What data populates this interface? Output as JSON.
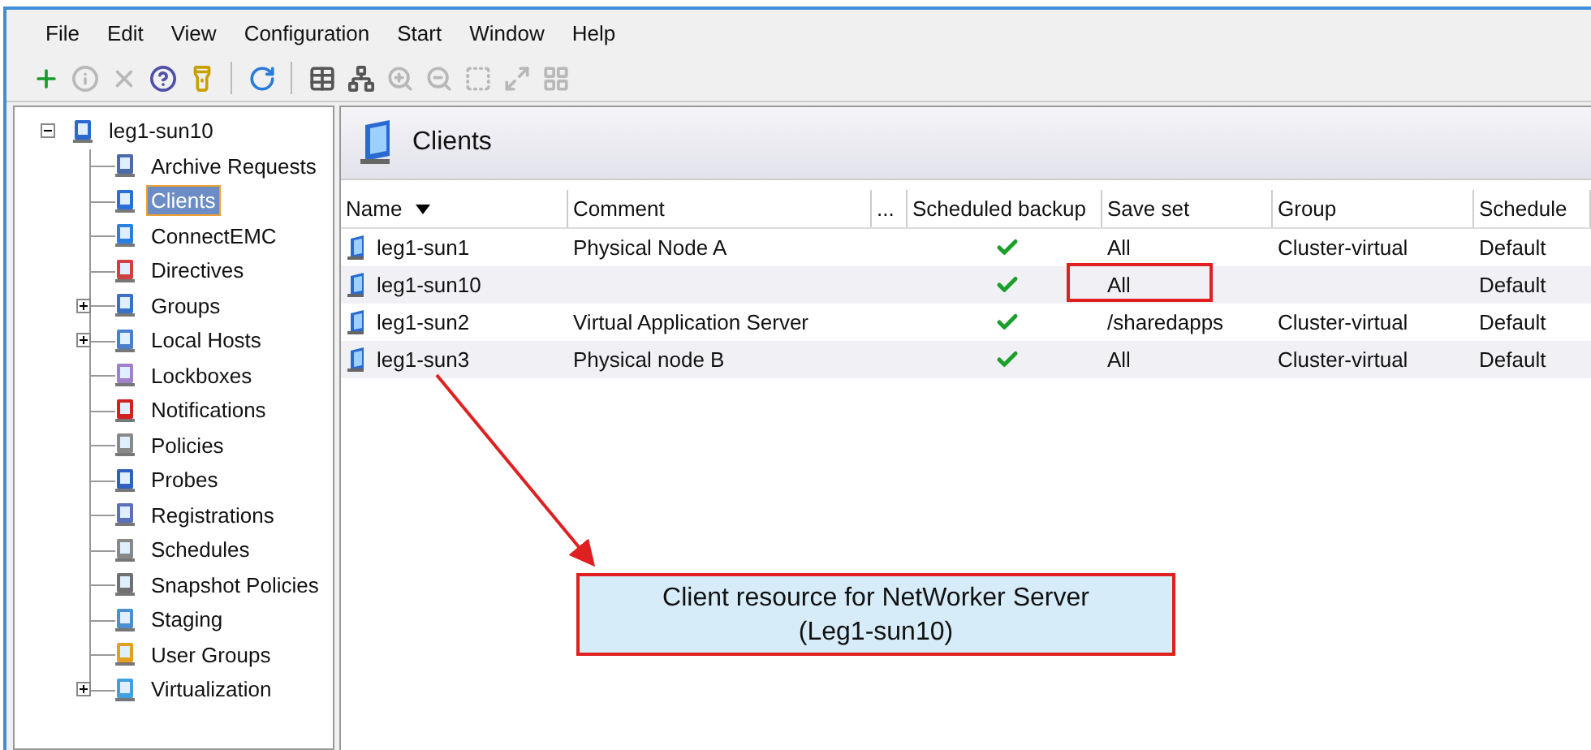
{
  "menu": [
    "File",
    "Edit",
    "View",
    "Configuration",
    "Start",
    "Window",
    "Help"
  ],
  "toolbar": [
    {
      "kind": "button",
      "disabled": false
    },
    {
      "kind": "button",
      "disabled": true
    },
    {
      "kind": "button",
      "disabled": true
    },
    {
      "kind": "button",
      "disabled": false
    },
    {
      "kind": "button",
      "disabled": false
    },
    {
      "kind": "separator"
    },
    {
      "kind": "button",
      "disabled": false
    },
    {
      "kind": "separator"
    },
    {
      "kind": "button",
      "disabled": false
    },
    {
      "kind": "button",
      "disabled": false
    },
    {
      "kind": "button",
      "disabled": true
    },
    {
      "kind": "button",
      "disabled": true
    },
    {
      "kind": "button",
      "disabled": true
    },
    {
      "kind": "button",
      "disabled": true
    },
    {
      "kind": "button",
      "disabled": true
    }
  ],
  "tree": {
    "label": "leg1-sun10",
    "expanded": true,
    "selected": false,
    "children": [
      {
        "label": "Archive Requests",
        "selected": false
      },
      {
        "label": "Clients",
        "selected": true
      },
      {
        "label": "ConnectEMC",
        "selected": false
      },
      {
        "label": "Directives",
        "selected": false
      },
      {
        "label": "Groups",
        "selected": false,
        "expanded": false
      },
      {
        "label": "Local Hosts",
        "selected": false,
        "expanded": false
      },
      {
        "label": "Lockboxes",
        "selected": false
      },
      {
        "label": "Notifications",
        "selected": false
      },
      {
        "label": "Policies",
        "selected": false
      },
      {
        "label": "Probes",
        "selected": false
      },
      {
        "label": "Registrations",
        "selected": false
      },
      {
        "label": "Schedules",
        "selected": false
      },
      {
        "label": "Snapshot Policies",
        "selected": false
      },
      {
        "label": "Staging",
        "selected": false
      },
      {
        "label": "User Groups",
        "selected": false
      },
      {
        "label": "Virtualization",
        "selected": false,
        "expanded": false
      }
    ]
  },
  "panel": {
    "title": "Clients"
  },
  "table": {
    "columns": [
      "Name",
      "Comment",
      "...",
      "Scheduled backup",
      "Save set",
      "Group",
      "Schedule"
    ],
    "rows": [
      {
        "name": "leg1-sun1",
        "comment": "Physical Node A",
        "scheduled": true,
        "save_set": "All",
        "group": "Cluster-virtual",
        "schedule": "Default",
        "highlighted": false
      },
      {
        "name": "leg1-sun10",
        "comment": "",
        "scheduled": true,
        "save_set": "All",
        "group": "",
        "schedule": "Default",
        "highlighted": true
      },
      {
        "name": "leg1-sun2",
        "comment": "Virtual Application Server",
        "scheduled": true,
        "save_set": "/sharedapps",
        "group": "Cluster-virtual",
        "schedule": "Default",
        "highlighted": false
      },
      {
        "name": "leg1-sun3",
        "comment": "Physical node B",
        "scheduled": true,
        "save_set": "All",
        "group": "Cluster-virtual",
        "schedule": "Default",
        "highlighted": false
      }
    ]
  },
  "callout": {
    "lines": [
      "Client resource for NetWorker Server",
      "(Leg1-sun10)"
    ]
  }
}
